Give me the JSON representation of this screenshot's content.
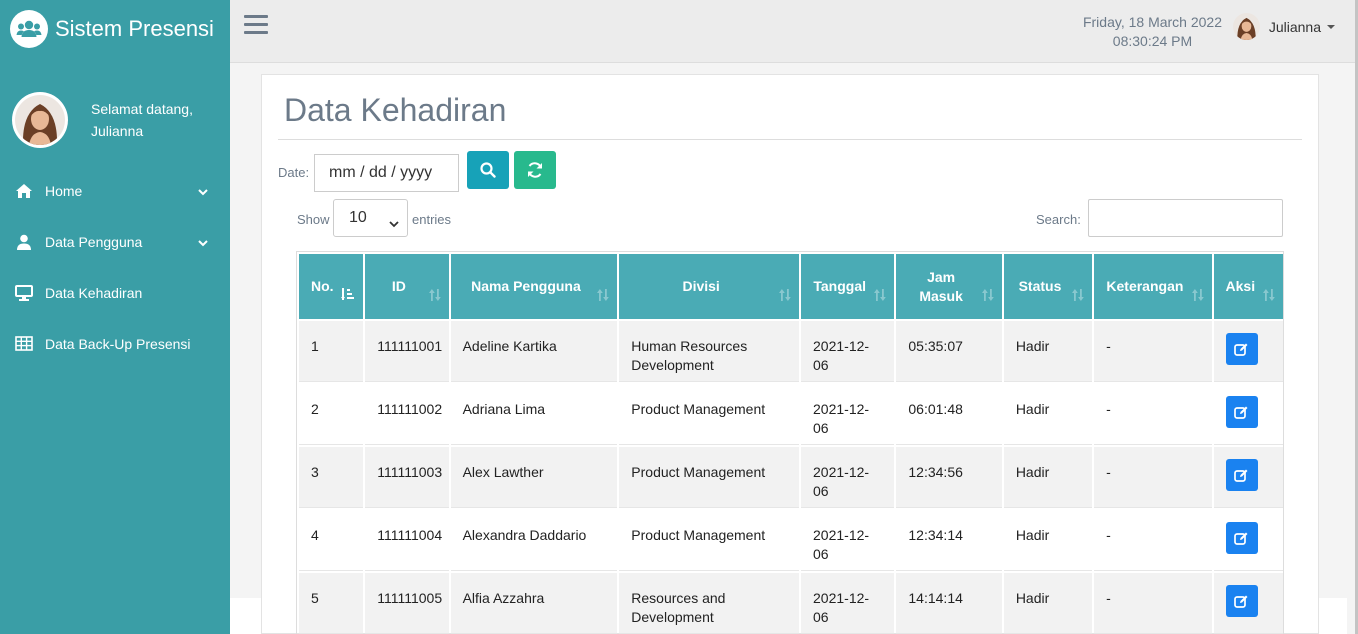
{
  "brand": {
    "title": "Sistem Presensi",
    "logo_icon": "users-icon"
  },
  "sidebar": {
    "greeting_line1": "Selamat datang,",
    "greeting_line2": "Julianna",
    "items": [
      {
        "label": "Home",
        "icon": "home-icon",
        "has_children": true
      },
      {
        "label": "Data Pengguna",
        "icon": "user-icon",
        "has_children": true
      },
      {
        "label": "Data Kehadiran",
        "icon": "monitor-icon",
        "has_children": false
      },
      {
        "label": "Data Back-Up Presensi",
        "icon": "table-icon",
        "has_children": false
      }
    ]
  },
  "topbar": {
    "date": "Friday, 18 March 2022",
    "time": "08:30:24 PM",
    "user_name": "Julianna"
  },
  "page": {
    "title": "Data Kehadiran",
    "date_label": "Date:",
    "date_placeholder": "mm / dd / yyyy",
    "show_label": "Show",
    "entries_value": "10",
    "entries_label": "entries",
    "search_label": "Search:",
    "search_value": ""
  },
  "table": {
    "columns": [
      "No.",
      "ID",
      "Nama Pengguna",
      "Divisi",
      "Tanggal",
      "Jam Masuk",
      "Status",
      "Keterangan",
      "Aksi"
    ],
    "column_lines": [
      [
        "No."
      ],
      [
        "ID"
      ],
      [
        "Nama Pengguna"
      ],
      [
        "Divisi"
      ],
      [
        "Tanggal"
      ],
      [
        "Jam",
        "Masuk"
      ],
      [
        "Status"
      ],
      [
        "Keterangan"
      ],
      [
        "Aksi"
      ]
    ],
    "rows": [
      {
        "no": "1",
        "id": "111111001",
        "nama": "Adeline Kartika",
        "divisi_l1": "Human Resources",
        "divisi_l2": "Development",
        "tanggal": "2021-12-06",
        "jam": "05:35:07",
        "status": "Hadir",
        "ket": "-"
      },
      {
        "no": "2",
        "id": "111111002",
        "nama": "Adriana Lima",
        "divisi_l1": "Product Management",
        "divisi_l2": "",
        "tanggal": "2021-12-06",
        "jam": "06:01:48",
        "status": "Hadir",
        "ket": "-"
      },
      {
        "no": "3",
        "id": "111111003",
        "nama": "Alex Lawther",
        "divisi_l1": "Product Management",
        "divisi_l2": "",
        "tanggal": "2021-12-06",
        "jam": "12:34:56",
        "status": "Hadir",
        "ket": "-"
      },
      {
        "no": "4",
        "id": "111111004",
        "nama": "Alexandra Daddario",
        "divisi_l1": "Product Management",
        "divisi_l2": "",
        "tanggal": "2021-12-06",
        "jam": "12:34:14",
        "status": "Hadir",
        "ket": "-"
      },
      {
        "no": "5",
        "id": "111111005",
        "nama": "Alfia Azzahra",
        "divisi_l1": "Resources and",
        "divisi_l2": "Development",
        "tanggal": "2021-12-06",
        "jam": "14:14:14",
        "status": "Hadir",
        "ket": "-"
      }
    ]
  },
  "colors": {
    "sidebar": "#3a9ea6",
    "table_header": "#4aabb5",
    "btn_search": "#17a2b8",
    "btn_refresh": "#28b98d",
    "btn_edit": "#1a82f0"
  }
}
